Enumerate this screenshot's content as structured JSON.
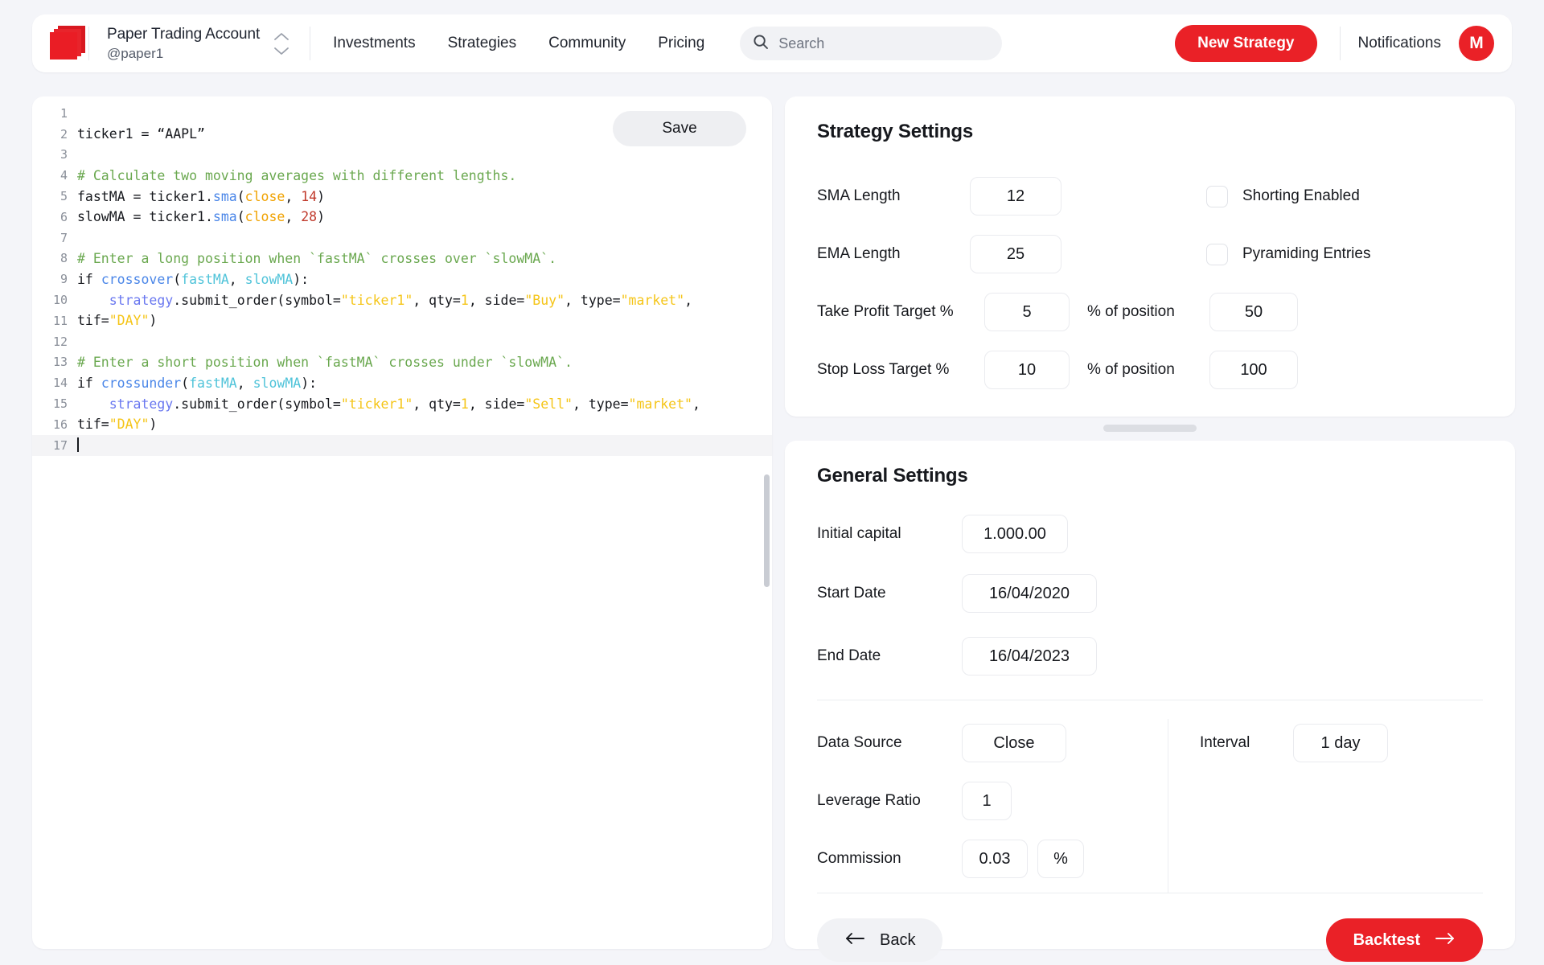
{
  "header": {
    "account_name": "Paper Trading Account",
    "account_handle": "@paper1",
    "nav": [
      {
        "label": "Investments"
      },
      {
        "label": "Strategies"
      },
      {
        "label": "Community"
      },
      {
        "label": "Pricing"
      }
    ],
    "search": {
      "placeholder": "Search",
      "value": ""
    },
    "new_strategy_label": "New Strategy",
    "notifications_label": "Notifications",
    "avatar_initial": "M"
  },
  "editor": {
    "save_label": "Save",
    "active_line": 17,
    "lines": [
      {
        "n": "1",
        "tokens": []
      },
      {
        "n": "2",
        "tokens": [
          {
            "t": "kw",
            "s": "ticker1 = “AAPL”"
          }
        ]
      },
      {
        "n": "3",
        "tokens": []
      },
      {
        "n": "4",
        "tokens": [
          {
            "t": "cm",
            "s": "# Calculate two moving averages with different lengths."
          }
        ]
      },
      {
        "n": "5",
        "tokens": [
          {
            "t": "kw",
            "s": "fastMA = ticker1."
          },
          {
            "t": "fn",
            "s": "sma"
          },
          {
            "t": "kw",
            "s": "("
          },
          {
            "t": "par",
            "s": "close"
          },
          {
            "t": "kw",
            "s": ", "
          },
          {
            "t": "num-red",
            "s": "14"
          },
          {
            "t": "kw",
            "s": ")"
          }
        ]
      },
      {
        "n": "6",
        "tokens": [
          {
            "t": "kw",
            "s": "slowMA = ticker1."
          },
          {
            "t": "fn",
            "s": "sma"
          },
          {
            "t": "kw",
            "s": "("
          },
          {
            "t": "par",
            "s": "close"
          },
          {
            "t": "kw",
            "s": ", "
          },
          {
            "t": "num-red",
            "s": "28"
          },
          {
            "t": "kw",
            "s": ")"
          }
        ]
      },
      {
        "n": "7",
        "tokens": []
      },
      {
        "n": "8",
        "tokens": [
          {
            "t": "cm",
            "s": "# Enter a long position when `fastMA` crosses over `slowMA`."
          }
        ]
      },
      {
        "n": "9",
        "tokens": [
          {
            "t": "kw",
            "s": "if "
          },
          {
            "t": "fn",
            "s": "crossover"
          },
          {
            "t": "kw",
            "s": "("
          },
          {
            "t": "var",
            "s": "fastMA"
          },
          {
            "t": "kw",
            "s": ", "
          },
          {
            "t": "var",
            "s": "slowMA"
          },
          {
            "t": "kw",
            "s": "):"
          }
        ]
      },
      {
        "n": "10",
        "tokens": [
          {
            "t": "kw",
            "s": "    "
          },
          {
            "t": "mod",
            "s": "strategy"
          },
          {
            "t": "kw",
            "s": ".submit_order(symbol="
          },
          {
            "t": "str",
            "s": "\"ticker1\""
          },
          {
            "t": "kw",
            "s": ", qty="
          },
          {
            "t": "num-y",
            "s": "1"
          },
          {
            "t": "kw",
            "s": ", side="
          },
          {
            "t": "str",
            "s": "\"Buy\""
          },
          {
            "t": "kw",
            "s": ", type="
          },
          {
            "t": "str",
            "s": "\"market\""
          },
          {
            "t": "kw",
            "s": ","
          }
        ]
      },
      {
        "n": "11",
        "tokens": [
          {
            "t": "kw",
            "s": "tif="
          },
          {
            "t": "str",
            "s": "\"DAY\""
          },
          {
            "t": "kw",
            "s": ")"
          }
        ]
      },
      {
        "n": "12",
        "tokens": []
      },
      {
        "n": "13",
        "tokens": [
          {
            "t": "cm",
            "s": "# Enter a short position when `fastMA` crosses under `slowMA`."
          }
        ]
      },
      {
        "n": "14",
        "tokens": [
          {
            "t": "kw",
            "s": "if "
          },
          {
            "t": "fn",
            "s": "crossunder"
          },
          {
            "t": "kw",
            "s": "("
          },
          {
            "t": "var",
            "s": "fastMA"
          },
          {
            "t": "kw",
            "s": ", "
          },
          {
            "t": "var",
            "s": "slowMA"
          },
          {
            "t": "kw",
            "s": "):"
          }
        ]
      },
      {
        "n": "15",
        "tokens": [
          {
            "t": "kw",
            "s": "    "
          },
          {
            "t": "mod",
            "s": "strategy"
          },
          {
            "t": "kw",
            "s": ".submit_order(symbol="
          },
          {
            "t": "str",
            "s": "\"ticker1\""
          },
          {
            "t": "kw",
            "s": ", qty="
          },
          {
            "t": "num-y",
            "s": "1"
          },
          {
            "t": "kw",
            "s": ", side="
          },
          {
            "t": "str",
            "s": "\"Sell\""
          },
          {
            "t": "kw",
            "s": ", type="
          },
          {
            "t": "str",
            "s": "\"market\""
          },
          {
            "t": "kw",
            "s": ","
          }
        ]
      },
      {
        "n": "16",
        "tokens": [
          {
            "t": "kw",
            "s": "tif="
          },
          {
            "t": "str",
            "s": "\"DAY\""
          },
          {
            "t": "kw",
            "s": ")"
          }
        ]
      },
      {
        "n": "17",
        "tokens": []
      }
    ]
  },
  "strategy_settings": {
    "title": "Strategy Settings",
    "sma_label": "SMA Length",
    "sma_value": "12",
    "ema_label": "EMA Length",
    "ema_value": "25",
    "take_profit_label": "Take Profit Target %",
    "take_profit_value": "5",
    "take_profit_pos_label": "% of position",
    "take_profit_pos_value": "50",
    "stop_loss_label": "Stop Loss Target %",
    "stop_loss_value": "10",
    "stop_loss_pos_label": "% of position",
    "stop_loss_pos_value": "100",
    "shorting_label": "Shorting Enabled",
    "shorting_checked": false,
    "pyramiding_label": "Pyramiding Entries",
    "pyramiding_checked": false
  },
  "general_settings": {
    "title": "General Settings",
    "initial_capital_label": "Initial capital",
    "initial_capital_value": "1.000.00",
    "start_date_label": "Start Date",
    "start_date_value": "16/04/2020",
    "end_date_label": "End Date",
    "end_date_value": "16/04/2023",
    "data_source_label": "Data Source",
    "data_source_value": "Close",
    "leverage_label": "Leverage Ratio",
    "leverage_value": "1",
    "commission_label": "Commission",
    "commission_value": "0.03",
    "commission_unit": "%",
    "interval_label": "Interval",
    "interval_value": "1 day",
    "back_label": "Back",
    "backtest_label": "Backtest"
  },
  "colors": {
    "brand_red": "#ea2127",
    "page_bg": "#f4f5f9",
    "panel_bg": "#ffffff"
  }
}
